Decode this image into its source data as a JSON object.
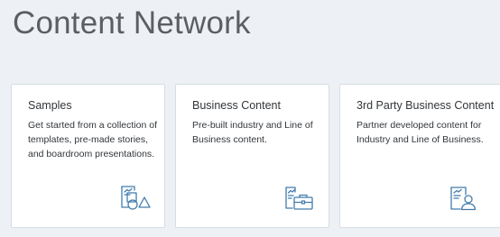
{
  "page": {
    "title": "Content Network"
  },
  "colors": {
    "background": "#edf1f5",
    "card": "#ffffff",
    "icon": "#427cac",
    "title_text": "#5b5e62"
  },
  "cards": [
    {
      "title": "Samples",
      "description": "Get started from a collection of templates, pre-made stories, and boardroom presentations.",
      "icon": "samples-shapes-icon"
    },
    {
      "title": "Business Content",
      "description": "Pre-built industry and Line of Business content.",
      "icon": "business-briefcase-icon"
    },
    {
      "title": "3rd Party Business Content",
      "description": "Partner developed content for Industry and Line of Business.",
      "icon": "partner-person-icon"
    }
  ]
}
